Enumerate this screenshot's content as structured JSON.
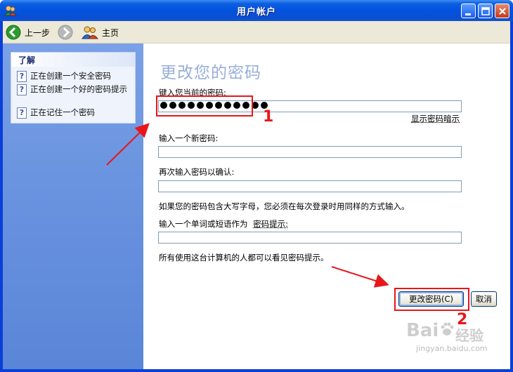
{
  "window": {
    "title": "用户帐户",
    "icon": "user-accounts-icon"
  },
  "toolbar": {
    "back_label": "上一步",
    "home_label": "主页"
  },
  "sidebar": {
    "header": "了解",
    "items": [
      {
        "label": "正在创建一个安全密码",
        "icon": "help-icon"
      },
      {
        "label": "正在创建一个好的密码提示",
        "icon": "help-icon"
      },
      {
        "label": "正在记住一个密码",
        "icon": "help-icon"
      }
    ]
  },
  "main": {
    "heading": "更改您的密码",
    "current_label": "键入您当前的密码:",
    "current_value_masked": "●●●●●●●●●●●●",
    "show_hint_link": "显示密码暗示",
    "new_label": "输入一个新密码:",
    "confirm_label": "再次输入密码以确认:",
    "case_note": "如果您的密码包含大写字母，您必须在每次登录时用同样的方式输入。",
    "hint_prefix": "输入一个单词或短语作为",
    "hint_link": "密码提示:",
    "visibility_note": "所有使用这台计算机的人都可以看见密码提示。",
    "change_button": "更改密码(C)",
    "cancel_button": "取消"
  },
  "annotations": {
    "step1": "1",
    "step2": "2",
    "color": "#e8161a"
  },
  "watermark": {
    "text": "Bai",
    "brand": "经验",
    "url": "jingyan.baidu.com"
  },
  "colors": {
    "title_blue": "#0353de",
    "sidebar_blue": "#6b94e0",
    "heading_color": "#97aed8"
  }
}
